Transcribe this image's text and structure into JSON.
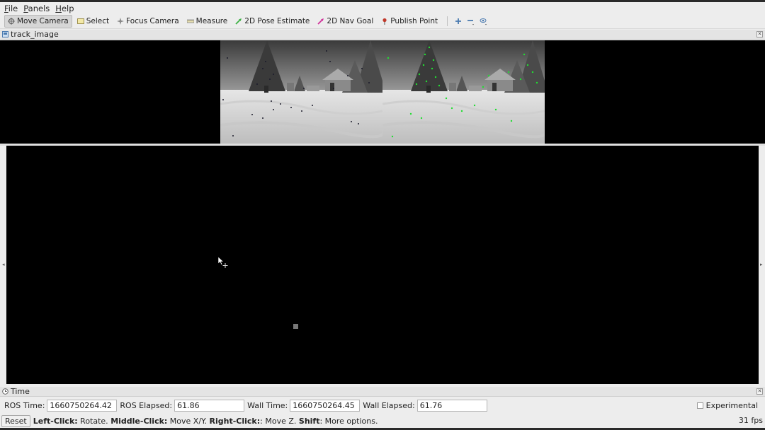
{
  "menu": {
    "file": "File",
    "panels": "Panels",
    "help": "Help"
  },
  "toolbar": {
    "tools": [
      {
        "label": "Move Camera",
        "icon": "move-camera-icon",
        "active": true
      },
      {
        "label": "Select",
        "icon": "select-icon"
      },
      {
        "label": "Focus Camera",
        "icon": "focus-camera-icon"
      },
      {
        "label": "Measure",
        "icon": "measure-icon"
      },
      {
        "label": "2D Pose Estimate",
        "icon": "pose-arrow-icon",
        "color": "#3cb043"
      },
      {
        "label": "2D Nav Goal",
        "icon": "nav-arrow-icon",
        "color": "#d0309a"
      },
      {
        "label": "Publish Point",
        "icon": "pin-icon",
        "color": "#c0392b"
      }
    ]
  },
  "image_panel": {
    "title": "track_image"
  },
  "time_panel": {
    "title": "Time",
    "ros_time_label": "ROS Time:",
    "ros_time": "1660750264.42",
    "ros_elapsed_label": "ROS Elapsed:",
    "ros_elapsed": "61.86",
    "wall_time_label": "Wall Time:",
    "wall_time": "1660750264.45",
    "wall_elapsed_label": "Wall Elapsed:",
    "wall_elapsed": "61.76",
    "experimental_label": "Experimental"
  },
  "status": {
    "reset_label": "Reset",
    "hint_left_key": "Left-Click:",
    "hint_left": " Rotate. ",
    "hint_middle_key": "Middle-Click:",
    "hint_middle": " Move X/Y. ",
    "hint_right_key": "Right-Click:",
    "hint_right": ": Move Z. ",
    "hint_shift_key": "Shift",
    "hint_shift": ": More options.",
    "fps": "31 fps"
  },
  "colors": {
    "feature_left": "#1a1a2a",
    "feature_right": "#22dd33",
    "viewport_bg": "#000000"
  }
}
